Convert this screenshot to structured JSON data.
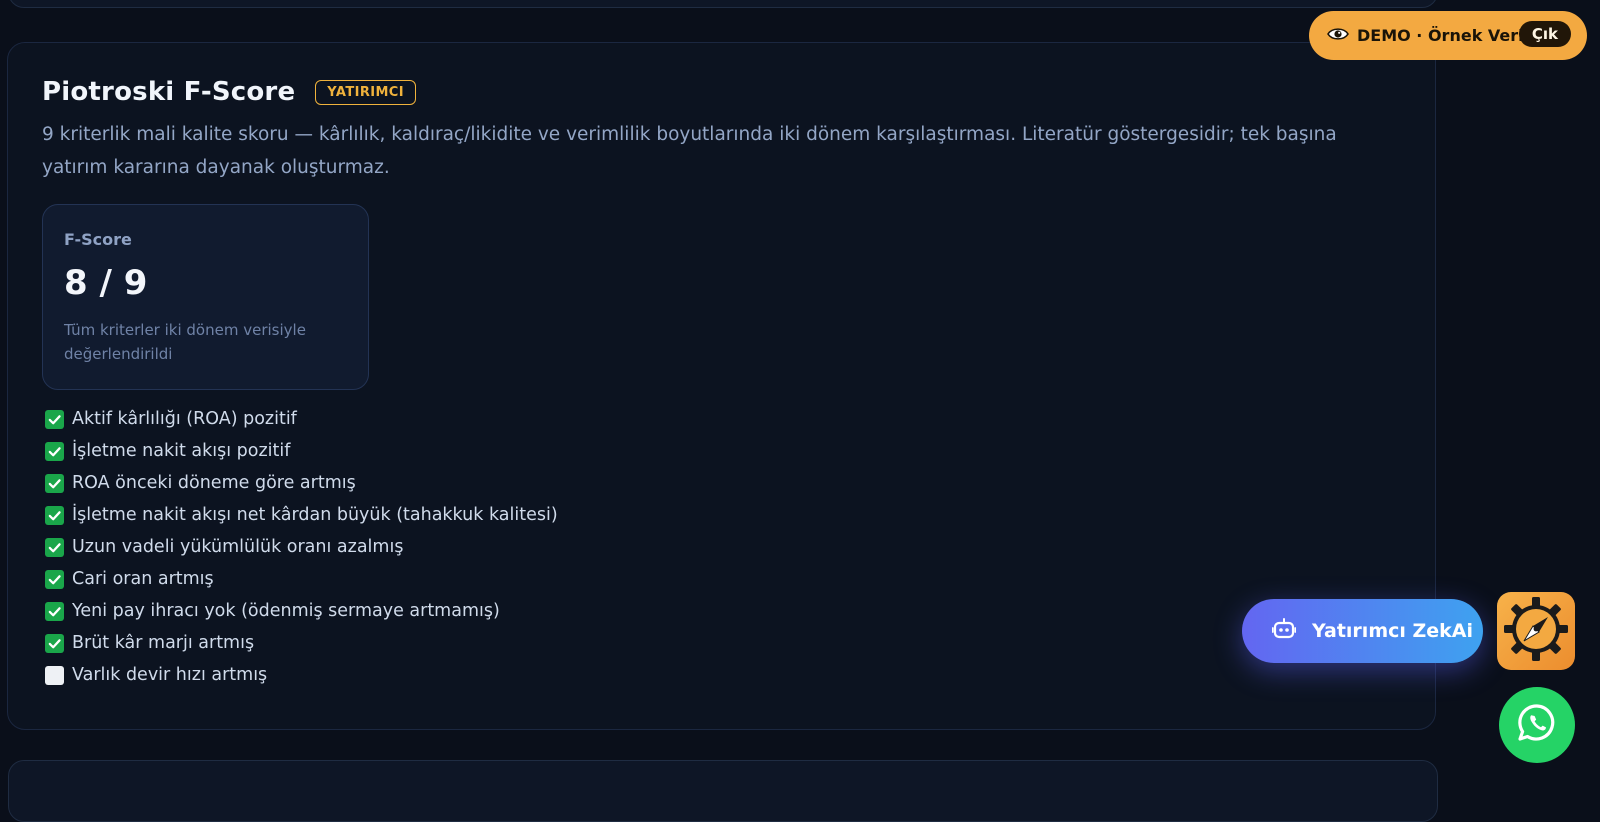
{
  "section": {
    "title": "Piotroski F-Score",
    "badge": "YATIRIMCI",
    "description": "9 kriterlik mali kalite skoru — kârlılık, kaldıraç/likidite ve verimlilik boyutlarında iki dönem karşılaştırması. Literatür göstergesidir; tek başına yatırım kararına dayanak oluşturmaz."
  },
  "score": {
    "label": "F-Score",
    "value": "8 / 9",
    "note": "Tüm kriterler iki dönem verisiyle değerlendirildi"
  },
  "criteria": [
    {
      "label": "Aktif kârlılığı (ROA) pozitif",
      "met": true
    },
    {
      "label": "İşletme nakit akışı pozitif",
      "met": true
    },
    {
      "label": "ROA önceki döneme göre artmış",
      "met": true
    },
    {
      "label": "İşletme nakit akışı net kârdan büyük (tahakkuk kalitesi)",
      "met": true
    },
    {
      "label": "Uzun vadeli yükümlülük oranı azalmış",
      "met": true
    },
    {
      "label": "Cari oran artmış",
      "met": true
    },
    {
      "label": "Yeni pay ihracı yok (ödenmiş sermaye artmamış)",
      "met": true
    },
    {
      "label": "Brüt kâr marjı artmış",
      "met": true
    },
    {
      "label": "Varlık devir hızı artmış",
      "met": false
    }
  ],
  "demo": {
    "icon": "eye-icon",
    "label": "DEMO · Örnek Veri",
    "exit_label": "Çık"
  },
  "assistant": {
    "icon": "robot-icon",
    "label": "Yatırımcı ZekAi"
  },
  "floating": {
    "compass_icon": "compass-gear-icon",
    "chat_icon": "whatsapp-icon"
  },
  "colors": {
    "background": "#0a0f1a",
    "accent_orange": "#f3a941",
    "badge_gold": "#f0b23c",
    "check_green": "#1aa64a",
    "whatsapp_green": "#25d366"
  }
}
